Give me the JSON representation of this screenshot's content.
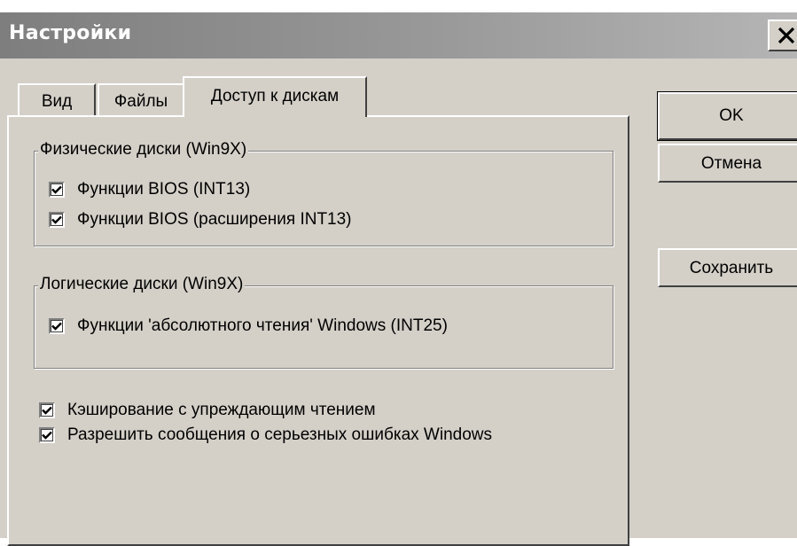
{
  "window": {
    "title": "Настройки"
  },
  "tabs": [
    {
      "label": "Вид",
      "active": false
    },
    {
      "label": "Файлы",
      "active": false
    },
    {
      "label": "Доступ к дискам",
      "active": true
    }
  ],
  "physical_group": {
    "label": "Физические диски (Win9X)",
    "options": [
      {
        "label": "Функции BIOS (INT13)",
        "checked": true
      },
      {
        "label": "Функции BIOS (расширения INT13)",
        "checked": true
      }
    ]
  },
  "logical_group": {
    "label": "Логические диски (Win9X)",
    "options": [
      {
        "label": "Функции 'абсолютного чтения' Windows (INT25)",
        "checked": true
      }
    ]
  },
  "extra_options": [
    {
      "label": "Кэширование с упреждающим чтением",
      "checked": true
    },
    {
      "label": "Разрешить сообщения о серьезных ошибках Windows",
      "checked": true
    }
  ],
  "buttons": {
    "ok": "OK",
    "cancel": "Отмена",
    "save": "Сохранить"
  }
}
